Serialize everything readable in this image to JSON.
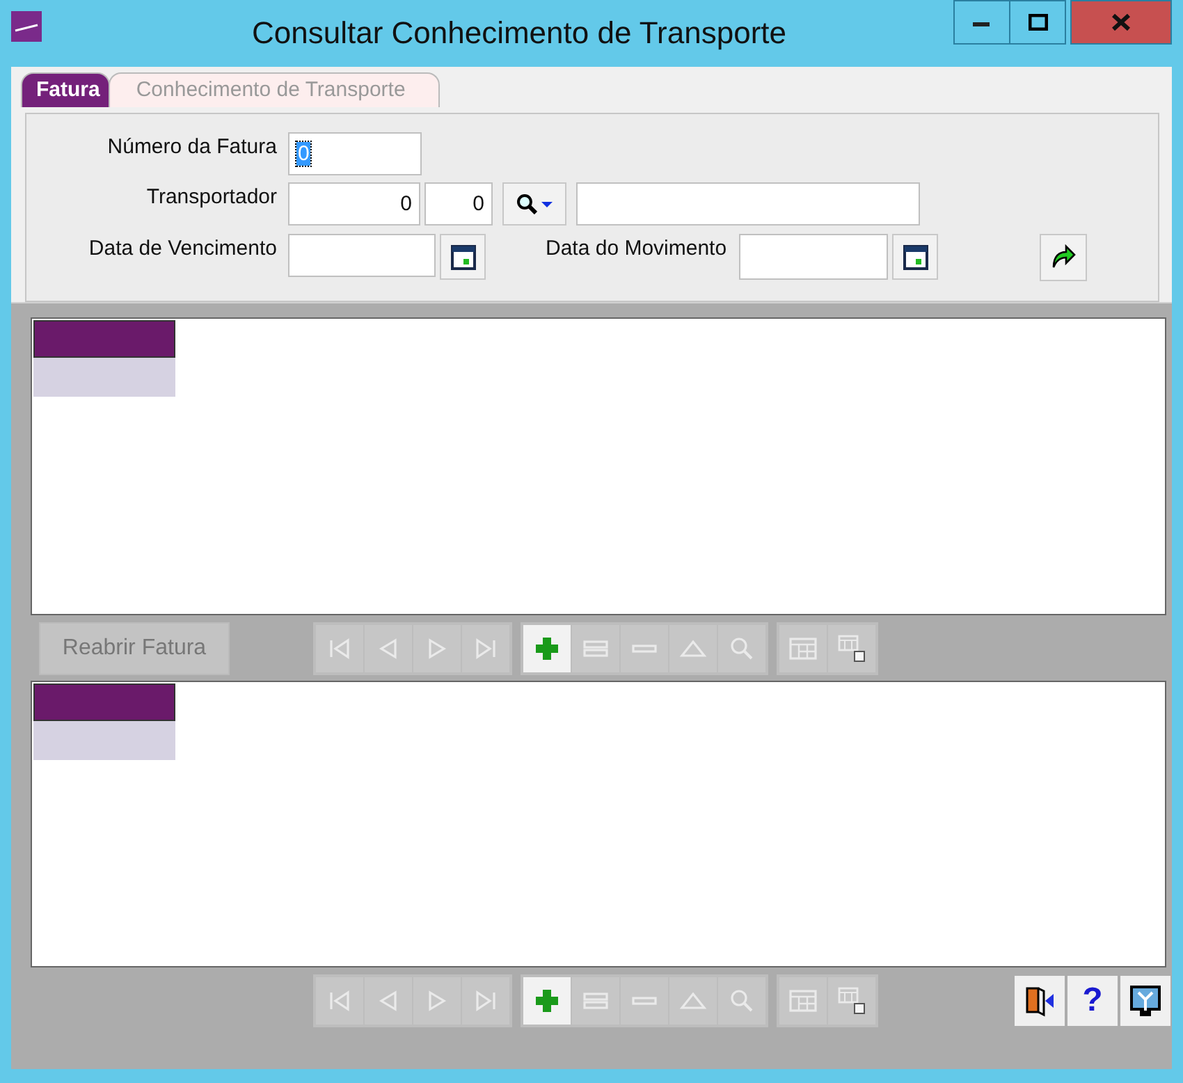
{
  "window": {
    "title": "Consultar Conhecimento de Transporte",
    "controls": [
      {
        "kind": "minimize"
      },
      {
        "kind": "maximize"
      },
      {
        "kind": "close"
      }
    ]
  },
  "tabs": [
    {
      "label": "Fatura",
      "selected": true
    },
    {
      "label": "Conhecimento de Transporte",
      "selected": false
    }
  ],
  "form": {
    "invoice_number": {
      "label": "Número da Fatura",
      "value": "0",
      "value_selected": true
    },
    "carrier": {
      "label": "Transportador",
      "code": "0",
      "branch": "0"
    },
    "due_date": {
      "label": "Data de Vencimento"
    },
    "movement_date": {
      "label": "Data do Movimento"
    }
  },
  "toolbar": {
    "reopen_button": {
      "label": "Reabrir Fatura",
      "disabled": true
    },
    "groups": [
      [
        {
          "kind": "first",
          "disabled": true
        },
        {
          "kind": "prev",
          "disabled": true
        },
        {
          "kind": "next",
          "disabled": true
        },
        {
          "kind": "last",
          "disabled": true
        }
      ],
      [
        {
          "kind": "add",
          "disabled": false
        },
        {
          "kind": "edit",
          "disabled": true
        },
        {
          "kind": "delete",
          "disabled": true
        },
        {
          "kind": "post",
          "disabled": true
        },
        {
          "kind": "search",
          "disabled": true
        }
      ],
      [
        {
          "kind": "grid",
          "disabled": true
        },
        {
          "kind": "export",
          "disabled": true
        }
      ]
    ]
  },
  "bottom_toolbar": {
    "groups": [
      [
        {
          "kind": "first",
          "disabled": true
        },
        {
          "kind": "prev",
          "disabled": true
        },
        {
          "kind": "next",
          "disabled": true
        },
        {
          "kind": "last",
          "disabled": true
        }
      ],
      [
        {
          "kind": "add",
          "disabled": false
        },
        {
          "kind": "edit",
          "disabled": true
        },
        {
          "kind": "delete",
          "disabled": true
        },
        {
          "kind": "post",
          "disabled": true
        },
        {
          "kind": "search",
          "disabled": true
        }
      ],
      [
        {
          "kind": "grid",
          "disabled": true
        },
        {
          "kind": "export",
          "disabled": true
        }
      ]
    ],
    "actions": [
      {
        "kind": "exit"
      },
      {
        "kind": "help",
        "label": "?"
      },
      {
        "kind": "config"
      }
    ]
  }
}
